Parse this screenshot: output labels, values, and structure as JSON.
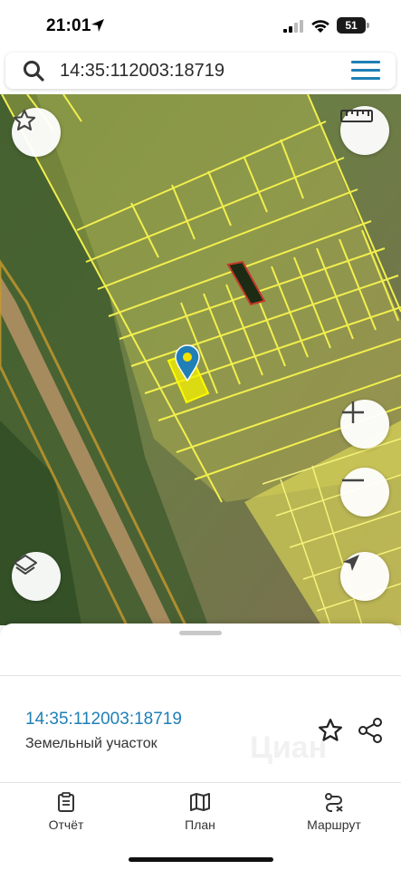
{
  "status_bar": {
    "time": "21:01",
    "battery": "51"
  },
  "search": {
    "query": "14:35:112003:18719",
    "icon": "search-icon",
    "menu_icon": "hamburger-menu-icon"
  },
  "map": {
    "parcel_fill_color": "#e8e35a",
    "parcel_stroke_color": "#f2ef4e",
    "selected_parcel_color": "#f5f000",
    "marker_color": "#1f7fb6",
    "buttons": [
      "star-icon",
      "ruler-icon",
      "zoom-in-icon",
      "zoom-out-icon",
      "layers-icon",
      "navigation-arrow-icon"
    ]
  },
  "sheet": {
    "parcel_number": "14:35:112003:18719",
    "parcel_type": "Земельный участок",
    "watermark": "Циан"
  },
  "tabs": [
    {
      "label": "Отчёт",
      "icon": "report-icon"
    },
    {
      "label": "План",
      "icon": "map-icon"
    },
    {
      "label": "Маршрут",
      "icon": "route-icon"
    }
  ],
  "colors": {
    "accent": "#1f7fb6",
    "text": "#333333"
  }
}
